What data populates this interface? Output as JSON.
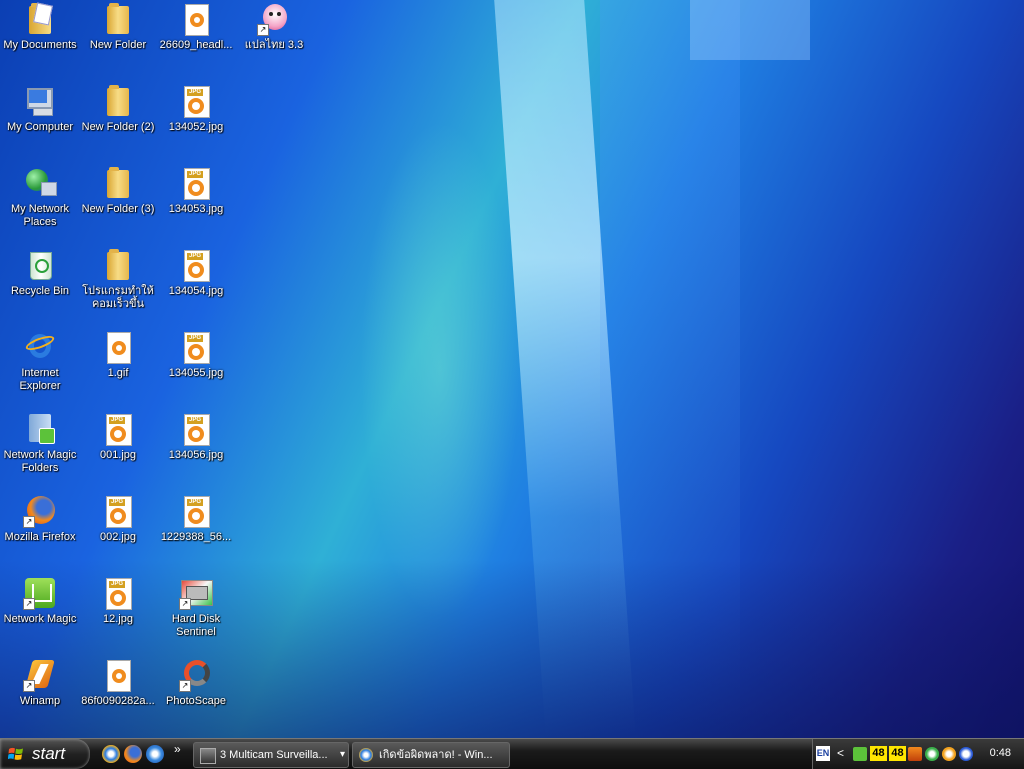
{
  "desktop": {
    "icons": [
      {
        "label": "My Documents"
      },
      {
        "label": "My Computer"
      },
      {
        "label": "My Network Places"
      },
      {
        "label": "Recycle Bin"
      },
      {
        "label": "Internet Explorer"
      },
      {
        "label": "Network Magic Folders"
      },
      {
        "label": "Mozilla Firefox"
      },
      {
        "label": "Network Magic"
      },
      {
        "label": "Winamp"
      },
      {
        "label": "New Folder"
      },
      {
        "label": "New Folder (2)"
      },
      {
        "label": "New Folder (3)"
      },
      {
        "label": "โปรแกรมทำให้คอมเร็วขึ้น"
      },
      {
        "label": "1.gif"
      },
      {
        "label": "001.jpg"
      },
      {
        "label": "002.jpg"
      },
      {
        "label": "12.jpg"
      },
      {
        "label": "86f0090282a..."
      },
      {
        "label": "26609_headl..."
      },
      {
        "label": "134052.jpg"
      },
      {
        "label": "134053.jpg"
      },
      {
        "label": "134054.jpg"
      },
      {
        "label": "134055.jpg"
      },
      {
        "label": "134056.jpg"
      },
      {
        "label": "1229388_56..."
      },
      {
        "label": "Hard Disk Sentinel"
      },
      {
        "label": "PhotoScape"
      },
      {
        "label": "แปลไทย 3.3"
      }
    ]
  },
  "taskbar": {
    "start_label": "start",
    "quick_launch_more": "»",
    "tasks": [
      {
        "label": "3 Multicam Surveilla...",
        "dropdown": "▾"
      },
      {
        "label": "เกิดข้อผิดพลาด! - Win..."
      }
    ],
    "tray": {
      "language": "EN",
      "arrow": "<",
      "num1": "48",
      "num2": "48",
      "clock": "0:48"
    }
  },
  "colors": {
    "jpg_orange": "#f08c1e",
    "folder_yellow": "#f7dc86",
    "tray_yellow": "#ffe600"
  }
}
